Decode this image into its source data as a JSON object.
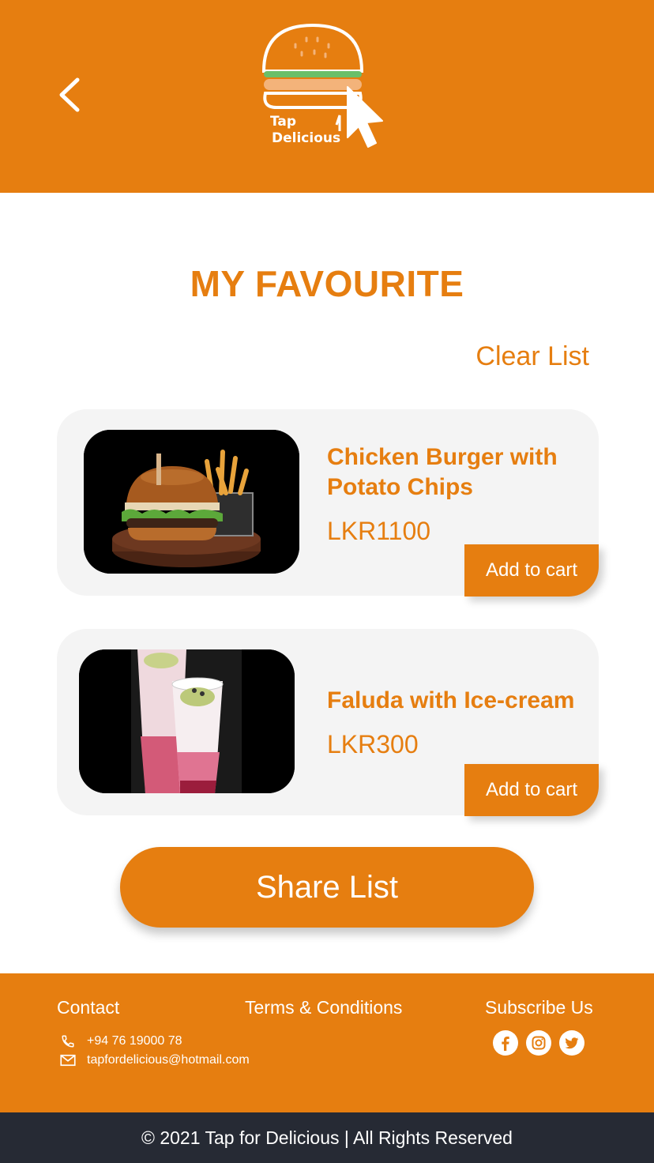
{
  "brand": {
    "logo_line1": "Tap",
    "logo_line2": "Delicious",
    "colors": {
      "primary": "#e67e10",
      "footer_bottom": "#262a34",
      "card_bg": "#f4f4f4"
    }
  },
  "nav": {
    "back_icon": "chevron-left-icon"
  },
  "main": {
    "title": "MY FAVOURITE",
    "clear_label": "Clear List",
    "items": [
      {
        "name": "Chicken Burger with Potato Chips",
        "price": "LKR1100",
        "cart_label": "Add to cart",
        "image": "burger-fries-photo"
      },
      {
        "name": "Faluda with Ice-cream",
        "price": "LKR300",
        "cart_label": "Add to cart",
        "image": "faluda-glasses-photo"
      }
    ],
    "share_label": "Share List"
  },
  "footer": {
    "contact_heading": "Contact",
    "terms_heading": "Terms & Conditions",
    "subscribe_heading": "Subscribe Us",
    "phone": "+94 76 19000 78",
    "email": "tapfordelicious@hotmail.com",
    "social_icons": [
      "facebook-icon",
      "instagram-icon",
      "twitter-icon"
    ],
    "copyright": "© 2021 Tap for Delicious | All Rights Reserved"
  }
}
